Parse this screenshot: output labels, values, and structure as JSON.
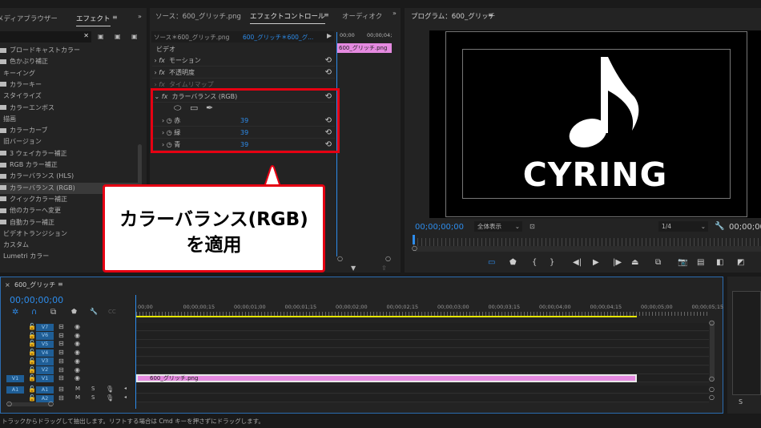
{
  "effects_panel": {
    "tabs": [
      "メディアブラウザー",
      "エフェクト"
    ],
    "items": [
      {
        "label": "ブロードキャストカラー",
        "folder": true
      },
      {
        "label": "色かぶり補正",
        "folder": true
      },
      {
        "label": "キーイング",
        "folder": false
      },
      {
        "label": "カラーキー",
        "folder": true
      },
      {
        "label": "スタイライズ",
        "folder": false
      },
      {
        "label": "カラーエンボス",
        "folder": true
      },
      {
        "label": "描画",
        "folder": false
      },
      {
        "label": "カラーカーブ",
        "folder": true
      },
      {
        "label": "旧バージョン",
        "folder": false
      },
      {
        "label": "3 ウェイカラー補正",
        "folder": true
      },
      {
        "label": "RGB カラー補正",
        "folder": true
      },
      {
        "label": "カラーバランス (HLS)",
        "folder": true
      },
      {
        "label": "カラーバランス (RGB)",
        "folder": true,
        "selected": true
      },
      {
        "label": "クイックカラー補正",
        "folder": true
      },
      {
        "label": "他のカラーへ変更",
        "folder": true
      },
      {
        "label": "自動カラー補正",
        "folder": true
      },
      {
        "label": "ビデオトランジション",
        "folder": false
      },
      {
        "label": "カスタム",
        "folder": false
      },
      {
        "label": "Lumetri カラー",
        "folder": false
      }
    ]
  },
  "effect_controls": {
    "tabs": [
      "ソース：600_グリッチ.png",
      "エフェクトコントロール",
      "オーディオク"
    ],
    "source": "ソース＊600_グリッチ.png",
    "sequence": "600_グリッチ＊600_グ...",
    "ruler": [
      "00;00",
      "00;00;04;"
    ],
    "clip": "600_グリッチ.png",
    "section": "ビデオ",
    "effects": [
      "モーション",
      "不透明度",
      "タイムリマップ"
    ],
    "color_balance": {
      "name": "カラーバランス (RGB)",
      "params": [
        {
          "label": "赤",
          "value": "39"
        },
        {
          "label": "緑",
          "value": "39"
        },
        {
          "label": "青",
          "value": "39"
        }
      ]
    }
  },
  "callout": {
    "line1": "カラーバランス(RGB)",
    "line2": "を適用"
  },
  "program": {
    "title": "プログラム：600_グリッチ",
    "logo_text": "CYRING",
    "timecode": "00;00;00;00",
    "fit": "全体表示",
    "resolution": "1/4",
    "timecode_right": "00;00;00"
  },
  "timeline": {
    "title": "600_グリッチ",
    "timecode": "00;00;00;00",
    "ticks": [
      "00;00",
      "00;00;00;15",
      "00;00;01;00",
      "00;00;01;15",
      "00;00;02;00",
      "00;00;02;15",
      "00;00;03;00",
      "00;00;03;15",
      "00;00;04;00",
      "00;00;04;15",
      "00;00;05;00",
      "00;00;05;15"
    ],
    "video_tracks": [
      "V7",
      "V6",
      "V5",
      "V4",
      "V3",
      "V2",
      "V1"
    ],
    "audio_tracks": [
      "A1",
      "A2"
    ],
    "source_v": "V1",
    "source_a": "A1",
    "clip": "600_グリッチ.png",
    "m": "M",
    "s": "S"
  },
  "status": "トラックからドラッグして抽出します。リフトする場合は Cmd キーを押さずにドラッグします。",
  "colors": {
    "accent": "#2d8ceb",
    "highlight": "#e60012",
    "clip": "#e58ae0"
  }
}
